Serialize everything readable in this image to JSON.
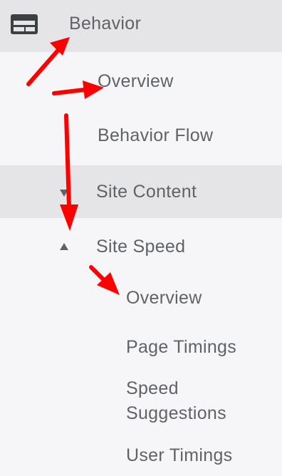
{
  "header": {
    "icon": "report-layout-icon",
    "title": "Behavior"
  },
  "nav": {
    "overview": "Overview",
    "behavior_flow": "Behavior Flow",
    "site_content": "Site Content",
    "site_speed": "Site Speed",
    "site_speed_items": {
      "overview": "Overview",
      "page_timings": "Page Timings",
      "speed_suggestions_line1": "Speed",
      "speed_suggestions_line2": "Suggestions",
      "user_timings": "User Timings"
    }
  },
  "colors": {
    "text": "#5f6368",
    "header_bg": "#e5e5e7",
    "selected_bg": "#e5e5e7",
    "panel_bg": "#f6f6f8",
    "annotation_arrow": "#ff0000"
  }
}
